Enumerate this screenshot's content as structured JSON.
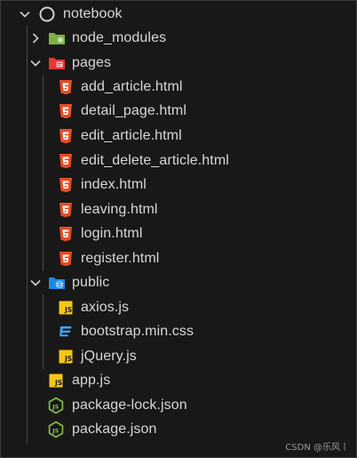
{
  "explorer": {
    "root": {
      "label": "notebook",
      "expanded": true,
      "icon": "circle-outline-icon"
    },
    "node_modules": {
      "label": "node_modules",
      "expanded": false,
      "icon": "folder-node-icon"
    },
    "pages": {
      "label": "pages",
      "expanded": true,
      "icon": "folder-pages-icon",
      "files": [
        {
          "label": "add_article.html",
          "icon": "html5-icon"
        },
        {
          "label": "detail_page.html",
          "icon": "html5-icon"
        },
        {
          "label": "edit_article.html",
          "icon": "html5-icon"
        },
        {
          "label": "edit_delete_article.html",
          "icon": "html5-icon"
        },
        {
          "label": "index.html",
          "icon": "html5-icon"
        },
        {
          "label": "leaving.html",
          "icon": "html5-icon"
        },
        {
          "label": "login.html",
          "icon": "html5-icon"
        },
        {
          "label": "register.html",
          "icon": "html5-icon"
        }
      ]
    },
    "public": {
      "label": "public",
      "expanded": true,
      "icon": "folder-public-icon",
      "files": [
        {
          "label": "axios.js",
          "icon": "js-icon"
        },
        {
          "label": "bootstrap.min.css",
          "icon": "css3-icon"
        },
        {
          "label": "jQuery.js",
          "icon": "js-icon"
        }
      ]
    },
    "root_files": [
      {
        "label": "app.js",
        "icon": "js-icon"
      },
      {
        "label": "package-lock.json",
        "icon": "nodejs-icon"
      },
      {
        "label": "package.json",
        "icon": "nodejs-icon"
      }
    ]
  },
  "watermark": "CSDN @乐风丨",
  "colors": {
    "background": "#181818",
    "text": "#d7d7d7",
    "html": "#e44d26",
    "js": "#f5c518",
    "css": "#42a5f5",
    "node": "#8bc34a",
    "folder_pages": "#ef5350",
    "folder_public": "#42a5f5",
    "folder_node": "#8bc34a"
  }
}
